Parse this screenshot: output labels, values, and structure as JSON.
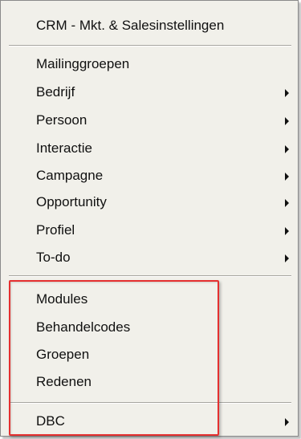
{
  "menu": {
    "header": "CRM - Mkt. & Salesinstellingen",
    "items": [
      {
        "label": "Mailinggroepen",
        "submenu": false
      },
      {
        "label": "Bedrijf",
        "submenu": true
      },
      {
        "label": "Persoon",
        "submenu": true
      },
      {
        "label": "Interactie",
        "submenu": true
      },
      {
        "label": "Campagne",
        "submenu": true
      },
      {
        "label": "Opportunity",
        "submenu": true
      },
      {
        "label": "Profiel",
        "submenu": true
      },
      {
        "label": "To-do",
        "submenu": true
      },
      {
        "label": "Modules",
        "submenu": false
      },
      {
        "label": "Behandelcodes",
        "submenu": false
      },
      {
        "label": "Groepen",
        "submenu": false
      },
      {
        "label": "Redenen",
        "submenu": false
      },
      {
        "label": "DBC",
        "submenu": true
      }
    ]
  },
  "colors": {
    "menu_background": "#f1f0ea",
    "highlight_border": "#e53030"
  }
}
